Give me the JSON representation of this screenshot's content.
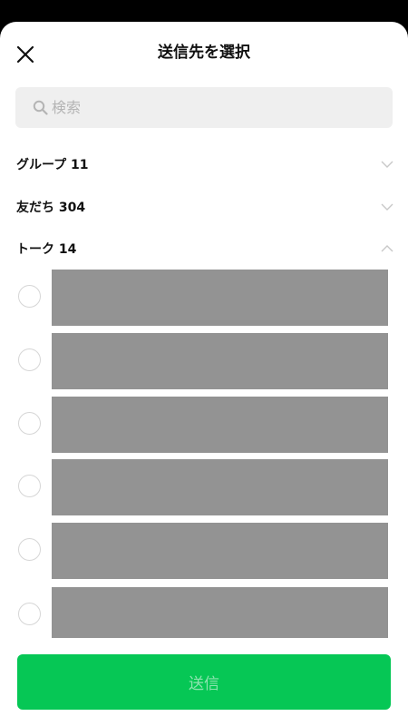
{
  "header": {
    "title": "送信先を選択",
    "close_icon": "close-icon"
  },
  "search": {
    "placeholder": "検索",
    "value": "",
    "icon": "search-icon"
  },
  "sections": [
    {
      "label": "グループ 11",
      "expanded": false
    },
    {
      "label": "友だち 304",
      "expanded": false
    },
    {
      "label": "トーク 14",
      "expanded": true
    }
  ],
  "talk_list": {
    "items": [
      {
        "selected": false,
        "content": "redacted"
      },
      {
        "selected": false,
        "content": "redacted"
      },
      {
        "selected": false,
        "content": "redacted"
      },
      {
        "selected": false,
        "content": "redacted"
      },
      {
        "selected": false,
        "content": "redacted"
      },
      {
        "selected": false,
        "content": "redacted"
      }
    ]
  },
  "footer": {
    "send_label": "送信"
  },
  "colors": {
    "accent": "#06c755",
    "accent_text_disabled": "#8ee3b0",
    "redaction": "#939393",
    "search_bg": "#efefef"
  }
}
